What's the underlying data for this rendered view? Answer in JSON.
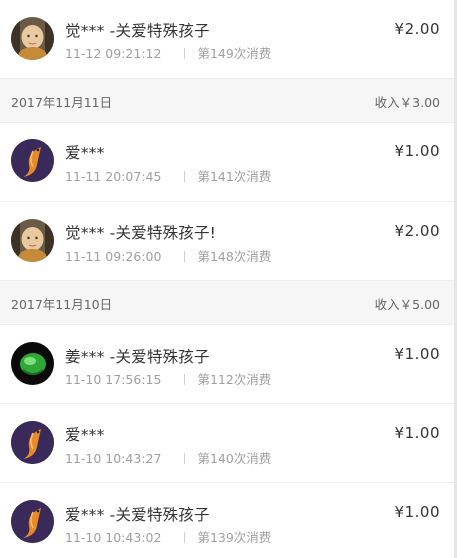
{
  "records_top": [
    {
      "avatar": "monk-avatar-icon",
      "name": "觉*** -关爱特殊孩子",
      "amount": "¥2.00",
      "datetime": "11-12 09:21:12",
      "count": "第149次消费"
    }
  ],
  "groups": [
    {
      "date": "2017年11月11日",
      "income": "收入￥3.00",
      "records": [
        {
          "avatar": "koi-avatar-icon",
          "name": "爱***",
          "amount": "¥1.00",
          "datetime": "11-11 20:07:45",
          "count": "第141次消费"
        },
        {
          "avatar": "monk-avatar-icon",
          "name": "觉*** -关爱特殊孩子!",
          "amount": "¥2.00",
          "datetime": "11-11 09:26:00",
          "count": "第148次消费"
        }
      ]
    },
    {
      "date": "2017年11月10日",
      "income": "收入￥5.00",
      "records": [
        {
          "avatar": "jade-avatar-icon",
          "name": "姜*** -关爱特殊孩子",
          "amount": "¥1.00",
          "datetime": "11-10 17:56:15",
          "count": "第112次消费"
        },
        {
          "avatar": "koi-avatar-icon",
          "name": "爱***",
          "amount": "¥1.00",
          "datetime": "11-10 10:43:27",
          "count": "第140次消费"
        },
        {
          "avatar": "koi-avatar-icon",
          "name": "爱*** -关爱特殊孩子",
          "amount": "¥1.00",
          "datetime": "11-10 10:43:02",
          "count": "第139次消费"
        }
      ]
    }
  ],
  "colors": {
    "text": "#333333",
    "meta": "#a0a0a0",
    "header_bg": "#f6f6f6"
  }
}
